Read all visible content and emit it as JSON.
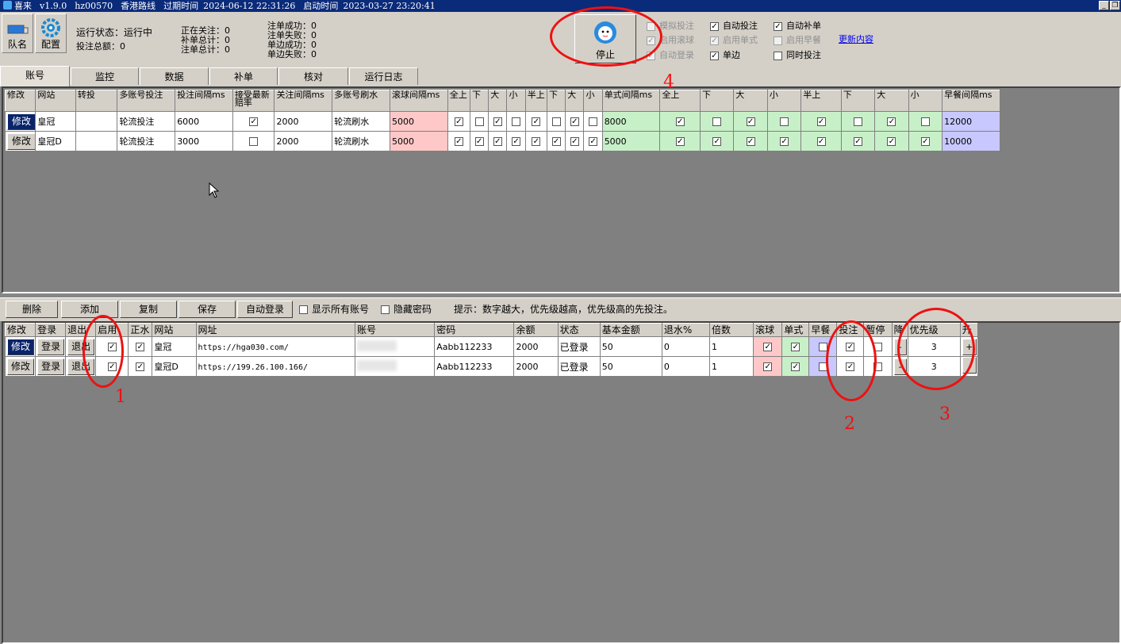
{
  "titlebar": {
    "app": "喜来",
    "version": "v1.9.0",
    "id": "hz00570",
    "route": "香港路线",
    "expire_label": "过期时间",
    "expire": "2024-06-12 22:31:26",
    "start_label": "启动时间",
    "start": "2023-03-27 23:20:41",
    "min": "_",
    "restore": "❐"
  },
  "toolbar": {
    "team_label": "队名",
    "config_label": "配置",
    "run_status": "运行状态：运行中",
    "bet_total": "投注总额：0",
    "following": "正在关注：0",
    "supplement_total": "补单总计：0",
    "note_total": "注单总计：0",
    "note_success": "注单成功：0",
    "note_fail": "注单失败：0",
    "single_success": "单边成功：0",
    "single_fail": "单边失败：0",
    "stop_label": "停止",
    "options": {
      "simulate": "模拟投注",
      "auto_bet": "自动投注",
      "auto_supplement": "自动补单",
      "enable_rolling": "启用滚球",
      "enable_single": "启用单式",
      "enable_early": "启用早餐",
      "auto_login": "自动登录",
      "single_side": "单边",
      "simultaneous": "同时投注",
      "update_link": "更新内容"
    }
  },
  "tabs": [
    "账号",
    "监控",
    "数据",
    "补单",
    "核对",
    "运行日志"
  ],
  "grid1": {
    "headers": [
      "修改",
      "网站",
      "转投",
      "多账号投注",
      "投注间隔ms",
      "接受最新赔率",
      "关注间隔ms",
      "多账号刷水",
      "滚球间隔ms",
      "全上",
      "下",
      "大",
      "小",
      "半上",
      "下",
      "大",
      "小",
      "单式间隔ms",
      "全上",
      "下",
      "大",
      "小",
      "半上",
      "下",
      "大",
      "小",
      "早餐间隔ms"
    ],
    "rows": [
      {
        "edit": "修改",
        "site": "皇冠",
        "mode": "轮流投注",
        "bet_interval": "6000",
        "follow_interval": "2000",
        "refresh": "轮流刷水",
        "rolling_interval": "5000",
        "single_interval": "8000",
        "early_interval": "12000",
        "checks": [
          1,
          0,
          1,
          0,
          1,
          0,
          1,
          0
        ],
        "checks2": [
          1,
          0,
          1,
          0,
          1,
          0,
          1,
          0
        ],
        "accept": 1
      },
      {
        "edit": "修改",
        "site": "皇冠D",
        "mode": "轮流投注",
        "bet_interval": "3000",
        "follow_interval": "2000",
        "refresh": "轮流刷水",
        "rolling_interval": "5000",
        "single_interval": "5000",
        "early_interval": "10000",
        "checks": [
          1,
          1,
          1,
          1,
          1,
          1,
          1,
          1
        ],
        "checks2": [
          1,
          1,
          1,
          1,
          1,
          1,
          1,
          1
        ],
        "accept": 0
      }
    ]
  },
  "bottombar": {
    "delete": "删除",
    "add": "添加",
    "copy": "复制",
    "save": "保存",
    "auto_login": "自动登录",
    "show_all": "显示所有账号",
    "hide_pwd": "隐藏密码",
    "tip": "提示：数字越大，优先级越高，优先级高的先投注。"
  },
  "grid2": {
    "headers": [
      "修改",
      "登录",
      "退出",
      "启用",
      "正水",
      "网站",
      "网址",
      "账号",
      "密码",
      "余额",
      "状态",
      "基本金额",
      "退水%",
      "倍数",
      "滚球",
      "单式",
      "早餐",
      "投注",
      "暂停",
      "降",
      "优先级",
      "升"
    ],
    "rows": [
      {
        "edit": "修改",
        "login": "登录",
        "logout": "退出",
        "site": "皇冠",
        "url": "https://hga030.com/",
        "password": "Aabb112233",
        "balance": "2000",
        "status": "已登录",
        "base": "50",
        "rebate": "0",
        "multiple": "1",
        "priority": "3",
        "minus": "-",
        "plus": "+"
      },
      {
        "edit": "修改",
        "login": "登录",
        "logout": "退出",
        "site": "皇冠D",
        "url": "https://199.26.100.166/",
        "password": "Aabb112233",
        "balance": "2000",
        "status": "已登录",
        "base": "50",
        "rebate": "0",
        "multiple": "1",
        "priority": "3",
        "minus": "-",
        "plus": ""
      }
    ]
  },
  "annotations": [
    "1",
    "2",
    "3",
    "4"
  ]
}
